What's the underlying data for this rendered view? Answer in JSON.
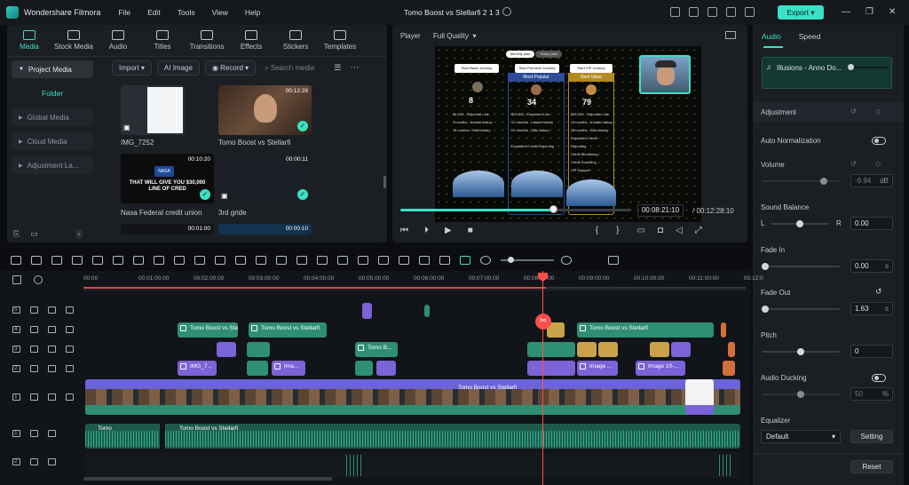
{
  "app": {
    "title": "Wondershare Filmora",
    "project_title": "Tomo Boost vs Stellarfi 2 1 3",
    "export_label": "Export",
    "accent": "#3ce0c4"
  },
  "menu": [
    "File",
    "Edit",
    "Tools",
    "View",
    "Help"
  ],
  "media_tabs": [
    {
      "label": "Media",
      "icon": "media-icon"
    },
    {
      "label": "Stock Media",
      "icon": "stock-media-icon"
    },
    {
      "label": "Audio",
      "icon": "music-icon"
    },
    {
      "label": "Titles",
      "icon": "titles-icon"
    },
    {
      "label": "Transitions",
      "icon": "transitions-icon"
    },
    {
      "label": "Effects",
      "icon": "effects-icon"
    },
    {
      "label": "Stickers",
      "icon": "stickers-icon"
    },
    {
      "label": "Templates",
      "icon": "templates-icon"
    }
  ],
  "sidebar": {
    "project_media": "Project Media",
    "folder": "Folder",
    "global_media": "Global Media",
    "cloud_media": "Cloud Media",
    "adjustment_layer": "Adjustment La..."
  },
  "media_toolbar": {
    "import": "Import",
    "ai_image": "AI Image",
    "record": "Record",
    "search_placeholder": "Search media"
  },
  "media_items": [
    {
      "name": "IMG_7252",
      "duration": ""
    },
    {
      "name": "Tomo Boost vs Stellarfi",
      "duration": "00:12:28"
    },
    {
      "name": "Nasa Federal credit union",
      "duration": "00:10:20",
      "overlay": "THAT WILL GIVE YOU $30,000 LINE OF CRED"
    },
    {
      "name": "3rd gride",
      "duration": "00:00:11"
    },
    {
      "name": "",
      "duration": "00:01:00"
    },
    {
      "name": "",
      "duration": "00:00:10"
    }
  ],
  "player": {
    "label": "Player",
    "quality": "Full Quality",
    "current_time": "00:08:21:10",
    "total_time": "00:12:28:10",
    "progress": 0.66
  },
  "preview": {
    "tabs": [
      "Monthly plan",
      "Yearly plan"
    ],
    "cards": [
      {
        "button": "Start Basic Journey",
        "badge": "",
        "price": "8"
      },
      {
        "button": "Start Premium Journey",
        "badge": "Most Popular",
        "price": "34"
      },
      {
        "button": "Start VIP Journey",
        "badge": "Best Value",
        "price": "79"
      }
    ],
    "lines": [
      [
        "$1,000 - Reported Line",
        "2 months - Instant history",
        "12 months - Bills history"
      ],
      [
        "$20,000 - Reported Line",
        "12 months - Instant history",
        "24 months - Bills history",
        "Expedited Credit Reporting"
      ],
      [
        "$50,000 - Reported Line",
        "24 months - Instant history",
        "36 months - Bills history",
        "Expedited Credit Reporting",
        "Credit Monitoring",
        "Credit Coaching",
        "VIP Support"
      ]
    ]
  },
  "right_panel": {
    "tabs": [
      "Audio",
      "Speed"
    ],
    "clip_name": "Illusions - Anno Do...",
    "adjustment": "Adjustment",
    "auto_normalization": "Auto Normalization",
    "volume": {
      "label": "Volume",
      "value": "-9.94",
      "unit": "dB"
    },
    "sound_balance": {
      "label": "Sound Balance",
      "left": "L",
      "right": "R",
      "value": "0.00"
    },
    "fade_in": {
      "label": "Fade In",
      "value": "0.00",
      "unit": "s"
    },
    "fade_out": {
      "label": "Fade Out",
      "value": "1.63",
      "unit": "s"
    },
    "pitch": {
      "label": "Pitch",
      "value": "0"
    },
    "audio_ducking": {
      "label": "Audio Ducking",
      "value": "50",
      "unit": "%"
    },
    "equalizer": {
      "label": "Equalizer",
      "value": "Default",
      "setting": "Setting"
    },
    "reset": "Reset"
  },
  "timeline": {
    "ticks": [
      "00:00",
      "00:01:00:00",
      "00:02:00:00",
      "00:03:00:00",
      "00:04:00:00",
      "00:05:00:00",
      "00:06:00:00",
      "00:07:00:00",
      "00:08:00:00",
      "00:09:00:00",
      "00:10:00:00",
      "00:11:00:00",
      "00:12:0"
    ],
    "tracks": [
      "5",
      "4",
      "3",
      "2",
      "1",
      "1",
      "2"
    ],
    "clips": {
      "tomo": "Tomo Boost vs Stellarfi",
      "tomo_short": "Tomo B...",
      "tomo_boo": "Tomo Boo...",
      "img": "IMG_7...",
      "ima": "Ima...",
      "image": "Image ...",
      "image10": "Image 10-...",
      "tomo_audio": "Tomo"
    }
  }
}
